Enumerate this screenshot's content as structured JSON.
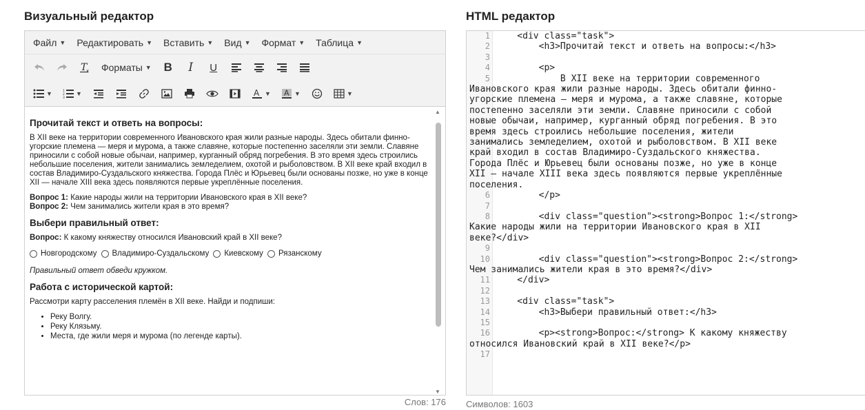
{
  "left": {
    "title": "Визуальный редактор",
    "menu": [
      "Файл",
      "Редактировать",
      "Вставить",
      "Вид",
      "Формат",
      "Таблица"
    ],
    "formats_label": "Форматы",
    "content": {
      "h1": "Прочитай текст и ответь на вопросы:",
      "paragraph": "В XII веке на территории современного Ивановского края жили разные народы. Здесь обитали финно-угорские племена — меря и мурома, а также славяне, которые постепенно заселяли эти земли. Славяне приносили с собой новые обычаи, например, курганный обряд погребения. В это время здесь строились небольшие поселения, жители занимались земледелием, охотой и рыболовством. В XII веке край входил в состав Владимиро-Суздальского княжества. Города Плёс и Юрьевец были основаны позже, но уже в конце XII — начале XIII века здесь появляются первые укреплённые поселения.",
      "q1_label": "Вопрос 1:",
      "q1_text": " Какие народы жили на территории Ивановского края в XII веке?",
      "q2_label": "Вопрос 2:",
      "q2_text": " Чем занимались жители края в это время?",
      "h2": "Выбери правильный ответ:",
      "q3_label": "Вопрос:",
      "q3_text": " К какому княжеству относился Ивановский край в XII веке?",
      "options": [
        "Новгородскому",
        "Владимиро-Суздальскому",
        "Киевскому",
        "Рязанскому"
      ],
      "hint": "Правильный ответ обведи кружком.",
      "h3": "Работа с исторической картой:",
      "map_task": "Рассмотри карту расселения племён в XII веке. Найди и подпиши:",
      "list": [
        "Реку Волгу.",
        "Реку Клязьму.",
        "Места, где жили меря и мурома (по легенде карты)."
      ]
    },
    "status": "Слов: 176"
  },
  "right": {
    "title": "HTML редактор",
    "lines": [
      {
        "n": "1",
        "text": "    <div class=\"task\">"
      },
      {
        "n": "2",
        "text": "        <h3>Прочитай текст и ответь на вопросы:</h3>"
      },
      {
        "n": "3",
        "text": ""
      },
      {
        "n": "4",
        "text": "        <p>"
      },
      {
        "n": "5",
        "text": "            В XII веке на территории современного\nИвановского края жили разные народы. Здесь обитали финно-\nугорские племена — меря и мурома, а также славяне, которые\nпостепенно заселяли эти земли. Славяне приносили с собой\nновые обычаи, например, курганный обряд погребения. В это\nвремя здесь строились небольшие поселения, жители\nзанимались земледелием, охотой и рыболовством. В XII веке\nкрай входил в состав Владимиро-Суздальского княжества.\nГорода Плёс и Юрьевец были основаны позже, но уже в конце\nXII — начале XIII века здесь появляются первые укреплённые\nпоселения."
      },
      {
        "n": "6",
        "text": "        </p>"
      },
      {
        "n": "7",
        "text": ""
      },
      {
        "n": "8",
        "text": "        <div class=\"question\"><strong>Вопрос 1:</strong>\nКакие народы жили на территории Ивановского края в XII\nвеке?</div>"
      },
      {
        "n": "9",
        "text": ""
      },
      {
        "n": "10",
        "text": "        <div class=\"question\"><strong>Вопрос 2:</strong>\nЧем занимались жители края в это время?</div>"
      },
      {
        "n": "11",
        "text": "    </div>"
      },
      {
        "n": "12",
        "text": ""
      },
      {
        "n": "13",
        "text": "    <div class=\"task\">"
      },
      {
        "n": "14",
        "text": "        <h3>Выбери правильный ответ:</h3>"
      },
      {
        "n": "15",
        "text": ""
      },
      {
        "n": "16",
        "text": "        <p><strong>Вопрос:</strong> К какому княжеству\nотносился Ивановский край в XII веке?</p>"
      },
      {
        "n": "17",
        "text": ""
      }
    ],
    "status": "Символов: 1603"
  }
}
